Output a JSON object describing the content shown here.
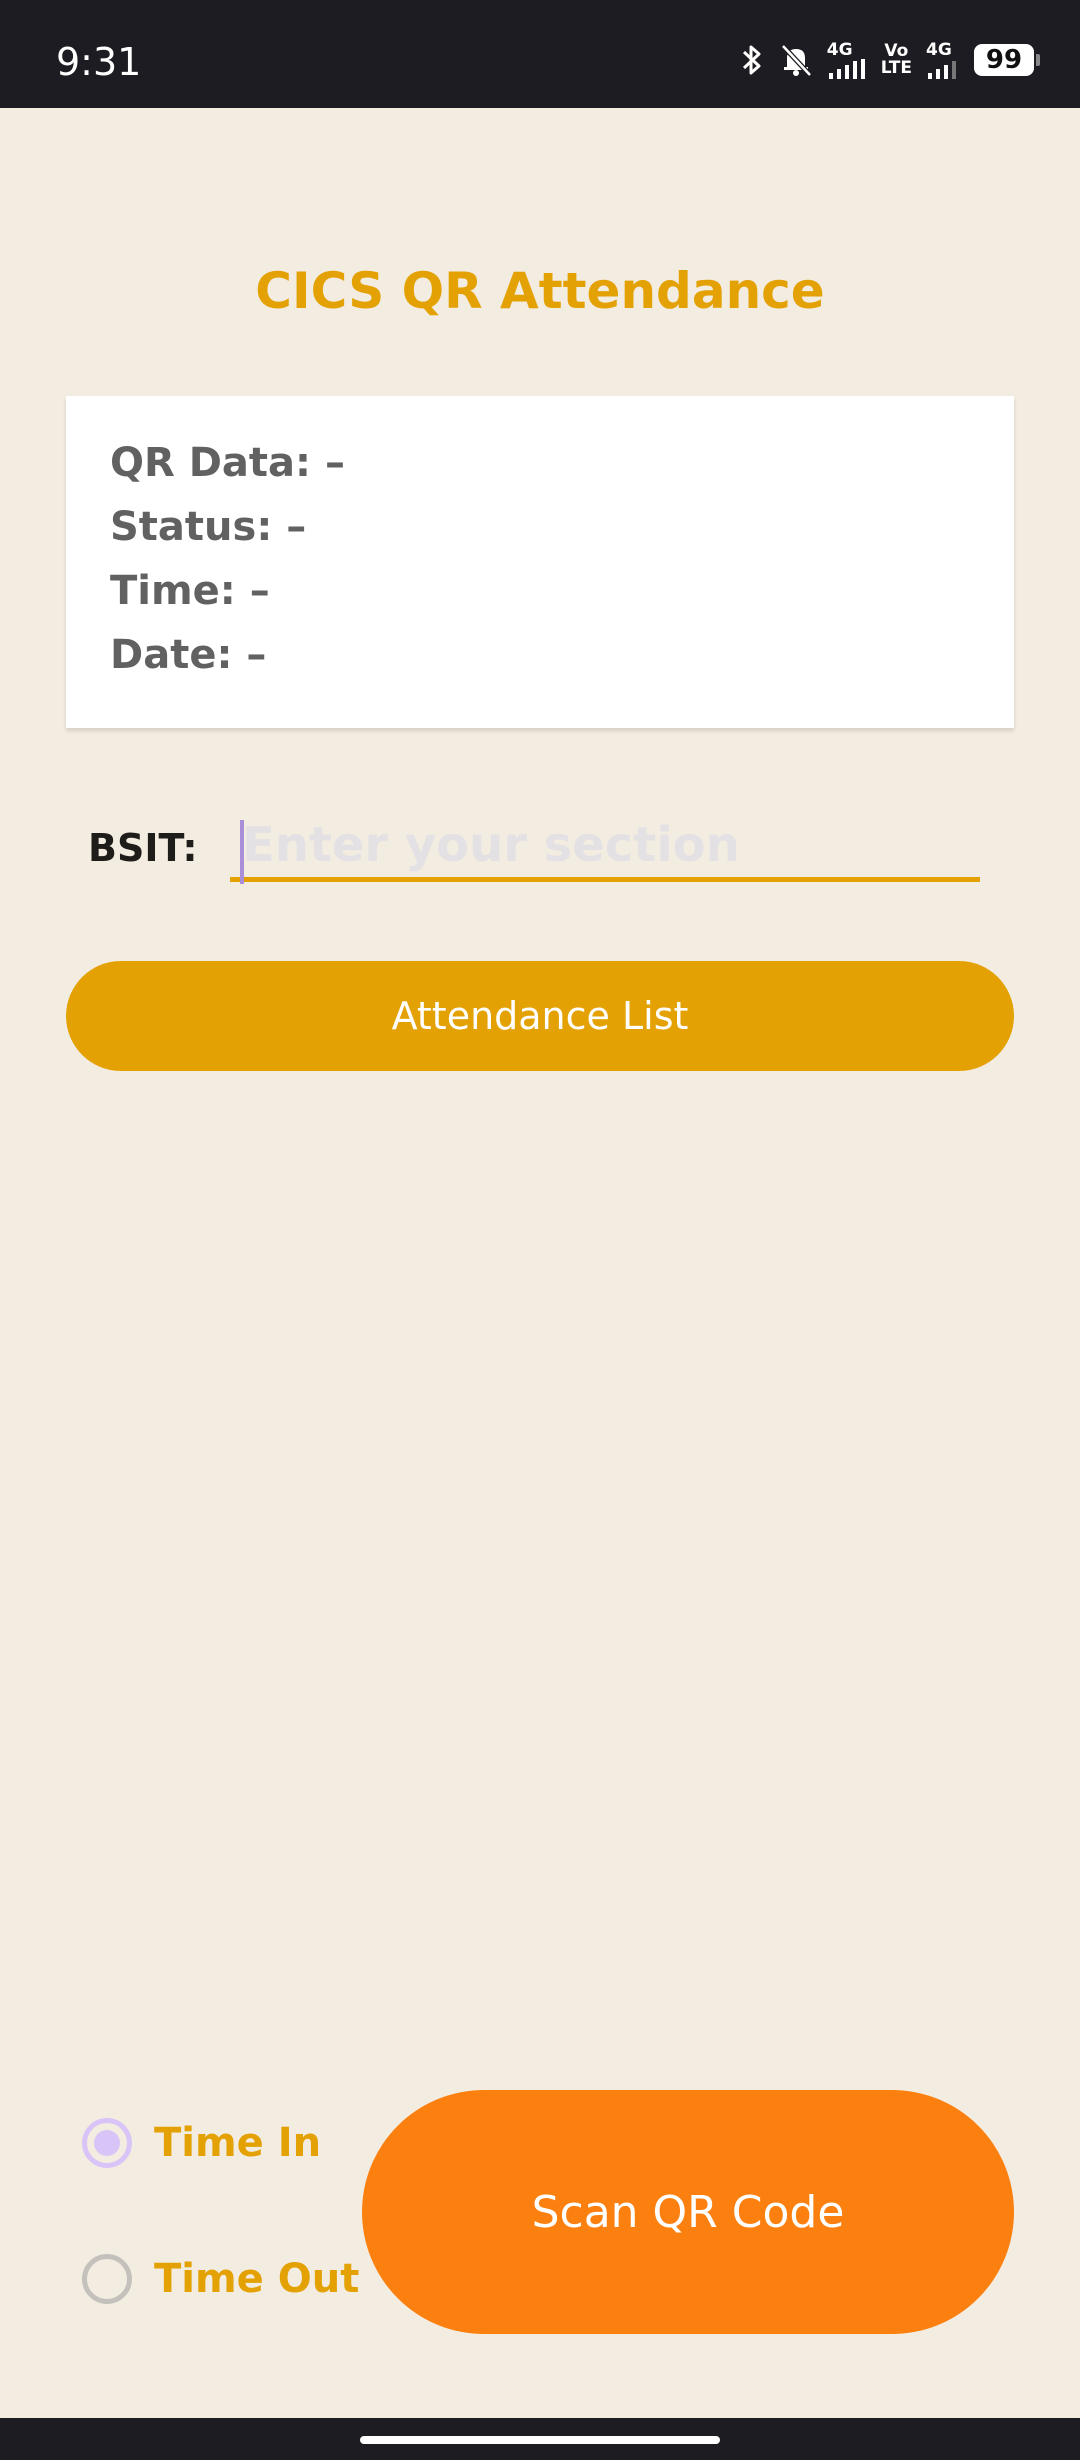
{
  "status_bar": {
    "time": "9:31",
    "battery": "99",
    "network_1": "4G",
    "volte_top": "Vo",
    "volte_bottom": "LTE",
    "network_2": "4G",
    "icons": [
      "bluetooth-icon",
      "bell-off-icon",
      "signal-icon",
      "signal-icon",
      "battery-icon"
    ]
  },
  "app": {
    "title": "CICS QR Attendance",
    "accent_color": "#e3a104",
    "scan_color": "#fc800f",
    "background_color": "#f3ece1"
  },
  "info_card": {
    "qr_data": "QR Data: –",
    "status": "Status: –",
    "time": "Time: –",
    "date": "Date: –"
  },
  "section": {
    "label": "BSIT:",
    "value": "",
    "placeholder": "Enter your section"
  },
  "attendance_button": {
    "label": "Attendance List"
  },
  "mode": {
    "options": [
      {
        "label": "Time In",
        "selected": true
      },
      {
        "label": "Time Out",
        "selected": false
      }
    ]
  },
  "scan_button": {
    "label": "Scan QR Code"
  }
}
